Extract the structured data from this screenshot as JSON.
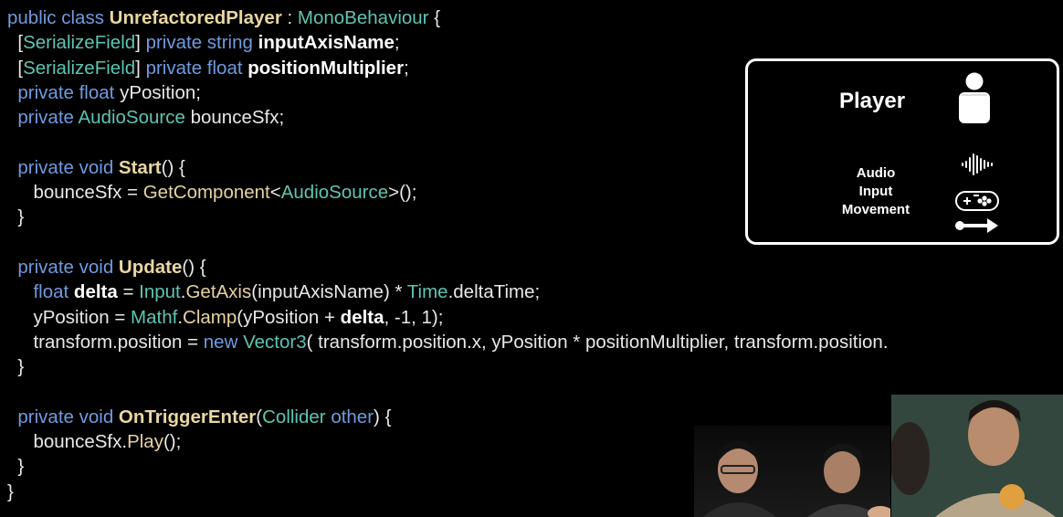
{
  "code": {
    "lines": [
      [
        {
          "t": "public class ",
          "c": "kw"
        },
        {
          "t": "UnrefactoredPlayer",
          "c": "fn"
        },
        {
          "t": " : ",
          "c": "plain"
        },
        {
          "t": "MonoBehaviour",
          "c": "type"
        },
        {
          "t": " {",
          "c": "plain"
        }
      ],
      [
        {
          "t": "  [",
          "c": "plain"
        },
        {
          "t": "SerializeField",
          "c": "type"
        },
        {
          "t": "] ",
          "c": "plain"
        },
        {
          "t": "private string ",
          "c": "kw"
        },
        {
          "t": "inputAxisName",
          "c": "bold"
        },
        {
          "t": ";",
          "c": "plain"
        }
      ],
      [
        {
          "t": "  [",
          "c": "plain"
        },
        {
          "t": "SerializeField",
          "c": "type"
        },
        {
          "t": "] ",
          "c": "plain"
        },
        {
          "t": "private float ",
          "c": "kw"
        },
        {
          "t": "positionMultiplier",
          "c": "bold"
        },
        {
          "t": ";",
          "c": "plain"
        }
      ],
      [
        {
          "t": "  private float ",
          "c": "kw"
        },
        {
          "t": "yPosition;",
          "c": "plain"
        }
      ],
      [
        {
          "t": "  private ",
          "c": "kw"
        },
        {
          "t": "AudioSource",
          "c": "type"
        },
        {
          "t": " bounceSfx;",
          "c": "plain"
        }
      ],
      [],
      [
        {
          "t": "  private void ",
          "c": "kw"
        },
        {
          "t": "Start",
          "c": "fn"
        },
        {
          "t": "() {",
          "c": "plain"
        }
      ],
      [
        {
          "t": "     bounceSfx = ",
          "c": "plain"
        },
        {
          "t": "GetComponent",
          "c": "method"
        },
        {
          "t": "<",
          "c": "plain"
        },
        {
          "t": "AudioSource",
          "c": "type"
        },
        {
          "t": ">();",
          "c": "plain"
        }
      ],
      [
        {
          "t": "  }",
          "c": "plain"
        }
      ],
      [],
      [
        {
          "t": "  private void ",
          "c": "kw"
        },
        {
          "t": "Update",
          "c": "fn"
        },
        {
          "t": "() {",
          "c": "plain"
        }
      ],
      [
        {
          "t": "     float ",
          "c": "kw"
        },
        {
          "t": "delta",
          "c": "bold"
        },
        {
          "t": " = ",
          "c": "plain"
        },
        {
          "t": "Input",
          "c": "type"
        },
        {
          "t": ".",
          "c": "plain"
        },
        {
          "t": "GetAxis",
          "c": "method"
        },
        {
          "t": "(inputAxisName) * ",
          "c": "plain"
        },
        {
          "t": "Time",
          "c": "type"
        },
        {
          "t": ".deltaTime;",
          "c": "plain"
        }
      ],
      [
        {
          "t": "     yPosition = ",
          "c": "plain"
        },
        {
          "t": "Mathf",
          "c": "type"
        },
        {
          "t": ".",
          "c": "plain"
        },
        {
          "t": "Clamp",
          "c": "method"
        },
        {
          "t": "(yPosition + ",
          "c": "plain"
        },
        {
          "t": "delta",
          "c": "bold"
        },
        {
          "t": ", -1, 1);",
          "c": "plain"
        }
      ],
      [
        {
          "t": "     transform.position = ",
          "c": "plain"
        },
        {
          "t": "new ",
          "c": "kw"
        },
        {
          "t": "Vector3",
          "c": "type"
        },
        {
          "t": "( transform.position.x, yPosition * positionMultiplier, transform.position.",
          "c": "plain"
        }
      ],
      [
        {
          "t": "  }",
          "c": "plain"
        }
      ],
      [],
      [
        {
          "t": "  private void ",
          "c": "kw"
        },
        {
          "t": "OnTriggerEnter",
          "c": "fn"
        },
        {
          "t": "(",
          "c": "plain"
        },
        {
          "t": "Collider",
          "c": "type"
        },
        {
          "t": " ",
          "c": "plain"
        },
        {
          "t": "other",
          "c": "kw"
        },
        {
          "t": ") {",
          "c": "plain"
        }
      ],
      [
        {
          "t": "     bounceSfx.",
          "c": "plain"
        },
        {
          "t": "Play",
          "c": "method"
        },
        {
          "t": "();",
          "c": "plain"
        }
      ],
      [
        {
          "t": "  }",
          "c": "plain"
        }
      ],
      [
        {
          "t": "}",
          "c": "plain"
        }
      ]
    ]
  },
  "diagram": {
    "title": "Player",
    "components": [
      "Audio",
      "Input",
      "Movement"
    ],
    "icons": [
      "person-icon",
      "audio-wave-icon",
      "gamepad-icon",
      "arrow-right-icon"
    ]
  }
}
